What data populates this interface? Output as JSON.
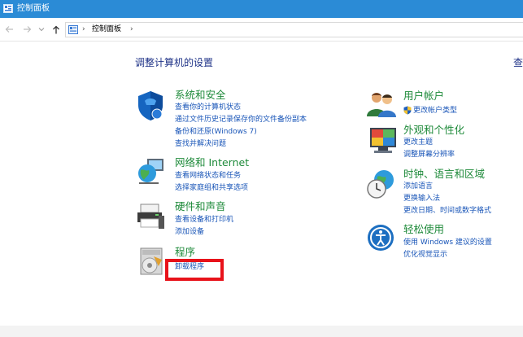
{
  "window": {
    "title": "控制面板"
  },
  "address_bar": {
    "crumb": "控制面板"
  },
  "main": {
    "heading": "调整计算机的设置",
    "search_edge": "查"
  },
  "categories": {
    "system": {
      "title": "系统和安全",
      "links": [
        "查看你的计算机状态",
        "通过文件历史记录保存你的文件备份副本",
        "备份和还原(Windows 7)",
        "查找并解决问题"
      ]
    },
    "network": {
      "title": "网络和 Internet",
      "links": [
        "查看网络状态和任务",
        "选择家庭组和共享选项"
      ]
    },
    "hardware": {
      "title": "硬件和声音",
      "links": [
        "查看设备和打印机",
        "添加设备"
      ]
    },
    "programs": {
      "title": "程序",
      "links": [
        "卸载程序"
      ]
    },
    "accounts": {
      "title": "用户帐户",
      "links": [
        "更改帐户类型"
      ]
    },
    "appearance": {
      "title": "外观和个性化",
      "links": [
        "更改主题",
        "调整屏幕分辨率"
      ]
    },
    "clock": {
      "title": "时钟、语言和区域",
      "links": [
        "添加语言",
        "更换输入法",
        "更改日期、时间或数字格式"
      ]
    },
    "ease": {
      "title": "轻松使用",
      "links": [
        "使用 Windows 建议的设置",
        "优化视觉显示"
      ]
    }
  },
  "colors": {
    "titlebar": "#2b8bd6",
    "category_title": "#1e8a3a",
    "link": "#1a56b8",
    "heading": "#1e3287",
    "highlight": "#e8121a"
  }
}
